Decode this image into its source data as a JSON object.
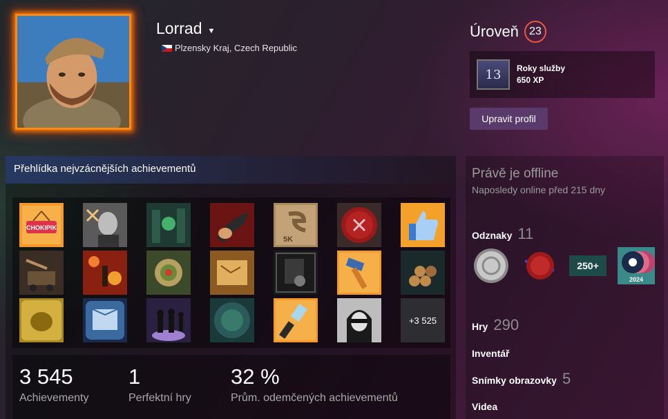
{
  "profile": {
    "name": "Lorrad",
    "location": "Plzensky Kraj, Czech Republic"
  },
  "level": {
    "label": "Úroveň",
    "value": "23",
    "badge_title": "Roky služby",
    "badge_xp": "650 XP",
    "badge_number": "13",
    "edit_label": "Upravit profil"
  },
  "showcase": {
    "title": "Přehlídka nejvzácnějších achievementů",
    "more_label": "+3 525",
    "icons": [
      "chokipik-sign-icon",
      "bald-man-portrait-icon",
      "green-ruins-icon",
      "red-demon-claw-icon",
      "5k-badge-icon",
      "red-skull-seal-icon",
      "thumbs-up-icon",
      "mine-cart-icon",
      "fire-figure-icon",
      "leaf-wreath-icon",
      "treasure-map-icon",
      "certificate-icon",
      "hammer-icon",
      "log-pile-icon",
      "gold-bust-icon",
      "blue-books-icon",
      "shadow-figures-icon",
      "teal-medallion-icon",
      "paint-brush-icon",
      "sunglasses-portrait-icon"
    ],
    "chokipik_text": "CHOKIPIK",
    "five_k_text": "5K",
    "stats": [
      {
        "value": "3 545",
        "label": "Achievementy"
      },
      {
        "value": "1",
        "label": "Perfektní hry"
      },
      {
        "value": "32 %",
        "label": "Prům. odemčených achievementů"
      }
    ]
  },
  "sidebar": {
    "status": "Právě je offline",
    "last_online": "Naposledy online před 215 dny",
    "badges_label": "Odznaky",
    "badges_count": "11",
    "badge_icons": [
      "silver-coin-badge-icon",
      "red-seal-badge-icon",
      "250-plus-badge-icon",
      "steam-2024-badge-icon"
    ],
    "badge_250_text": "250+",
    "badge_2024_text": "2024",
    "games_label": "Hry",
    "games_count": "290",
    "inventory_label": "Inventář",
    "screenshots_label": "Snímky obrazovky",
    "screenshots_count": "5",
    "videos_label": "Videa"
  },
  "colors": {
    "avatar_frame": "#ff8a10",
    "level_ring": "#e9573d",
    "edit_button": "#5a3a6a"
  }
}
